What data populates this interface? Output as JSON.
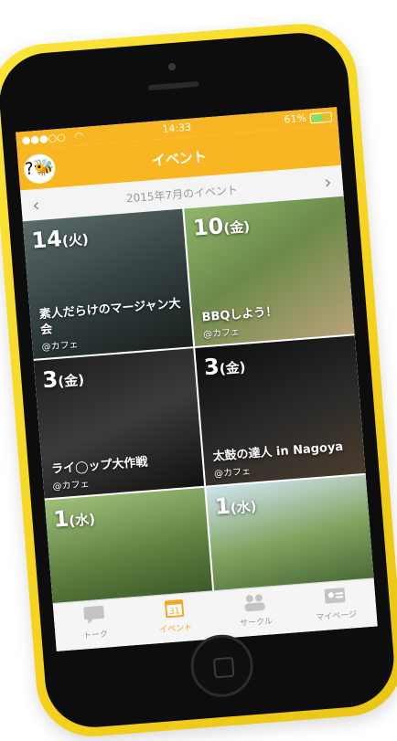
{
  "status": {
    "time": "14:33",
    "battery": "61%"
  },
  "header": {
    "title": "イベント",
    "logo_text": "?🐝"
  },
  "month": {
    "label": "2015年7月のイベント",
    "prev": "‹",
    "next": "›"
  },
  "events": [
    {
      "day": "14",
      "dow": "(火)",
      "title": "素人だらけのマージャン大会",
      "venue": "@カフェ"
    },
    {
      "day": "10",
      "dow": "(金)",
      "title": "BBQしよう！",
      "venue": "@カフェ"
    },
    {
      "day": "3",
      "dow": "(金)",
      "title": "ライ◯ップ大作戦",
      "venue": "@カフェ"
    },
    {
      "day": "3",
      "dow": "(金)",
      "title": "太鼓の達人 in Nagoya",
      "venue": "@カフェ"
    },
    {
      "day": "1",
      "dow": "(水)",
      "title": "",
      "venue": ""
    },
    {
      "day": "1",
      "dow": "(水)",
      "title": "",
      "venue": ""
    }
  ],
  "tabs": [
    {
      "label": "トーク",
      "icon": "chat-icon"
    },
    {
      "label": "イベント",
      "icon": "calendar-icon",
      "badge": "31"
    },
    {
      "label": "サークル",
      "icon": "group-icon"
    },
    {
      "label": "マイページ",
      "icon": "profile-card-icon"
    }
  ],
  "colors": {
    "accent": "#f8b722",
    "tab_active": "#f5a623",
    "phone": "#f4d21e"
  }
}
